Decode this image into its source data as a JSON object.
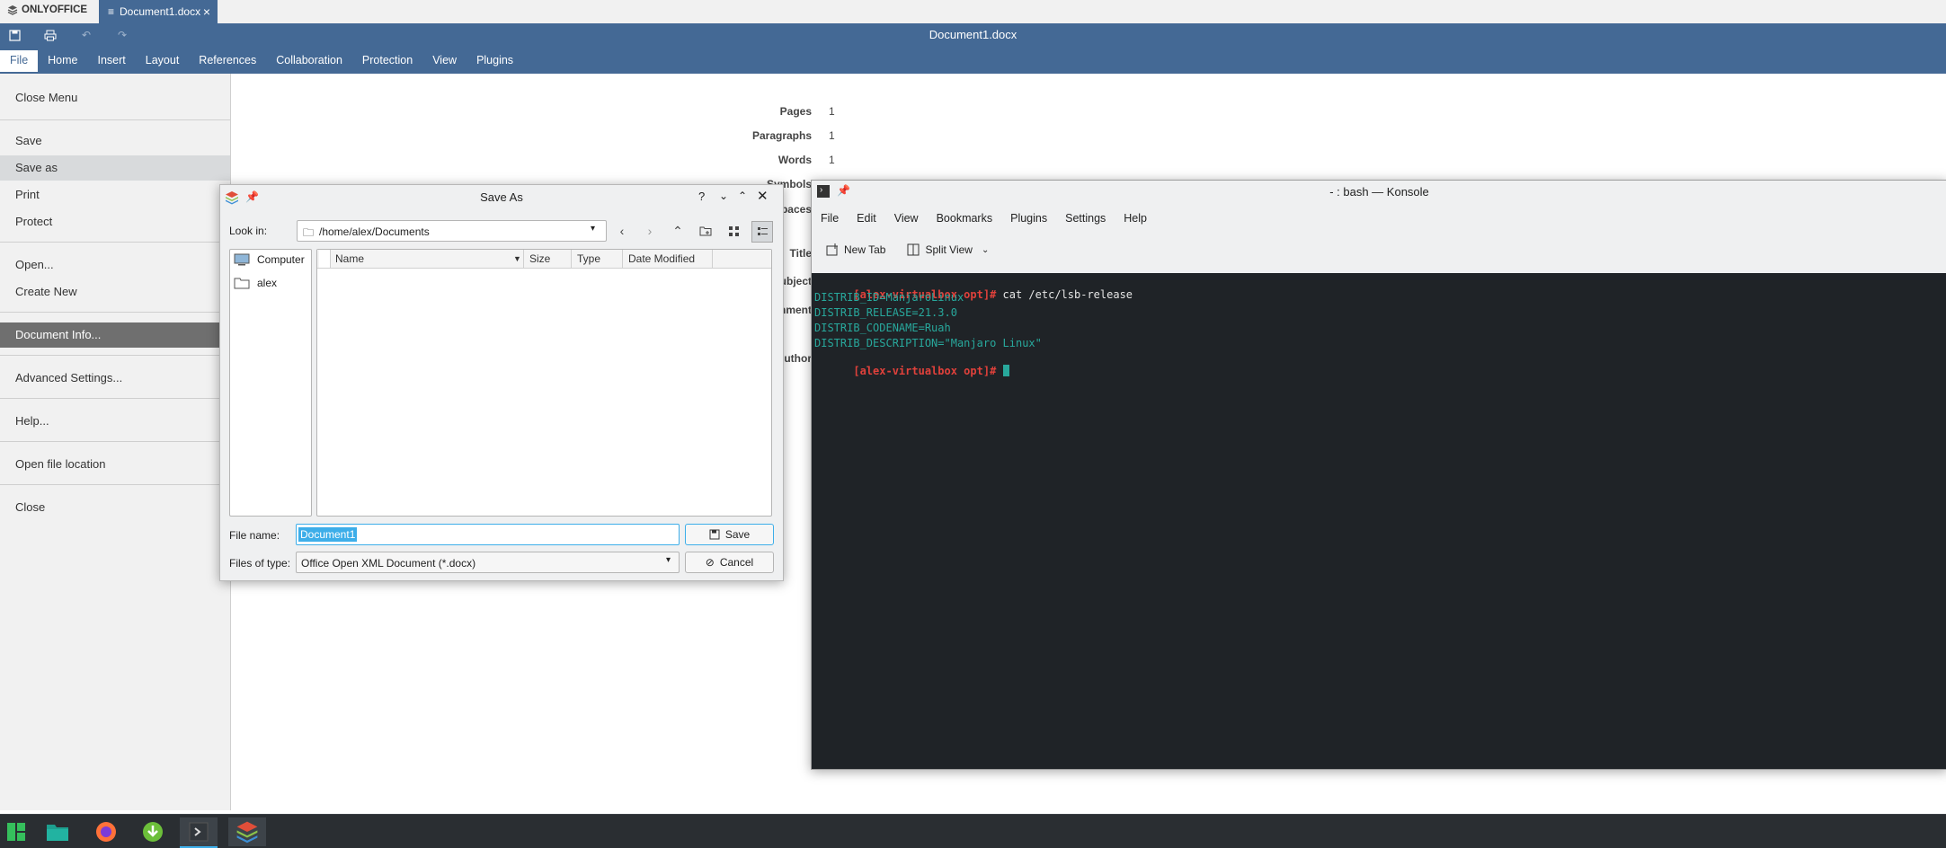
{
  "app": {
    "brand": "ONLYOFFICE",
    "tab_label": "Document1.docx",
    "title": "Document1.docx"
  },
  "menubar": [
    "File",
    "Home",
    "Insert",
    "Layout",
    "References",
    "Collaboration",
    "Protection",
    "View",
    "Plugins"
  ],
  "filemenu": {
    "items": [
      "Close Menu",
      "Save",
      "Save as",
      "Print",
      "Protect",
      "Open...",
      "Create New",
      "Document Info...",
      "Advanced Settings...",
      "Help...",
      "Open file location",
      "Close"
    ]
  },
  "docinfo": {
    "labels": [
      "Pages",
      "Paragraphs",
      "Words",
      "Symbols",
      "paces",
      "Title",
      "ubject",
      "mment",
      "uthor"
    ],
    "values": [
      "1",
      "1",
      "1"
    ]
  },
  "save_dialog": {
    "title": "Save As",
    "look_in_label": "Look in:",
    "look_in_value": "/home/alex/Documents",
    "places": [
      "Computer",
      "alex"
    ],
    "columns": [
      "Name",
      "Size",
      "Type",
      "Date Modified"
    ],
    "filename_label": "File name:",
    "filename_value": "Document1",
    "filetype_label": "Files of type:",
    "filetype_value": "Office Open XML Document (*.docx)",
    "save_label": "Save",
    "cancel_label": "Cancel"
  },
  "konsole": {
    "title": "- : bash — Konsole",
    "menu": [
      "File",
      "Edit",
      "View",
      "Bookmarks",
      "Plugins",
      "Settings",
      "Help"
    ],
    "new_tab": "New Tab",
    "split_view": "Split View",
    "prompt": "[alex-virtualbox opt]#",
    "command": " cat /etc/lsb-release",
    "output": [
      "DISTRIB_ID=ManjaroLinux",
      "DISTRIB_RELEASE=21.3.0",
      "DISTRIB_CODENAME=Ruah",
      "DISTRIB_DESCRIPTION=\"Manjaro Linux\""
    ]
  },
  "colors": {
    "oo_blue": "#446995",
    "terminal_bg": "#1f2327",
    "prompt_red": "#e0413b",
    "output_teal": "#28a89c",
    "selection": "#3daee9"
  },
  "taskbar": {
    "icons": [
      "manjaro-menu-icon",
      "file-manager-icon",
      "firefox-icon",
      "download-icon",
      "konsole-icon",
      "onlyoffice-icon"
    ]
  }
}
